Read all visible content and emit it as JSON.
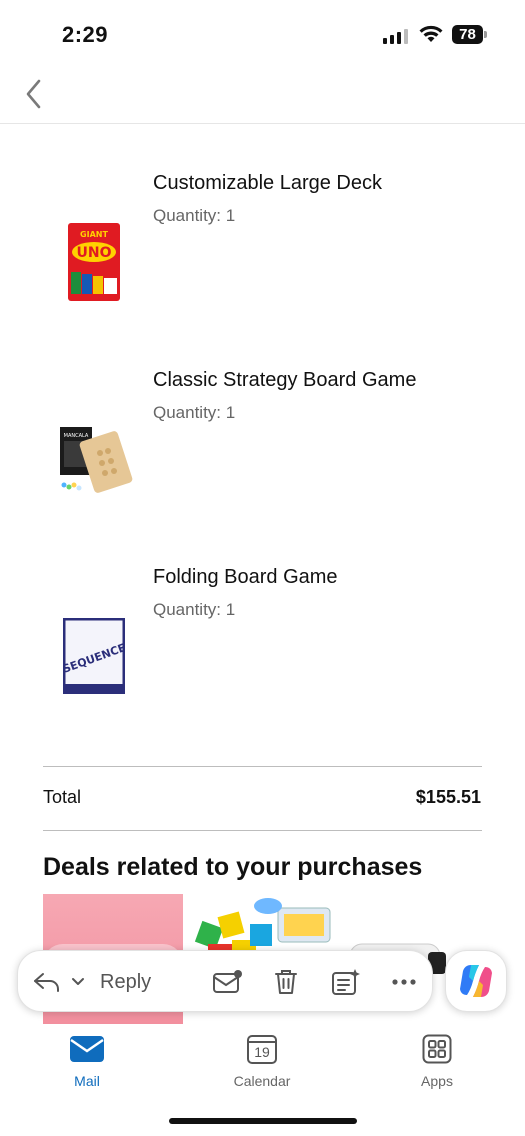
{
  "status_bar": {
    "time": "2:29",
    "battery_level": "78"
  },
  "header": {
    "back_icon": "chevron-left-icon"
  },
  "items": [
    {
      "title": "Customizable Large Deck",
      "quantity": "Quantity: 1",
      "thumb_text": "GIANT UNO"
    },
    {
      "title": "Classic Strategy Board Game",
      "quantity": "Quantity: 1",
      "thumb_text": "MANCALA"
    },
    {
      "title": "Folding Board Game",
      "quantity": "Quantity: 1",
      "thumb_text": "SEQUENCE"
    }
  ],
  "summary": {
    "total_label": "Total",
    "total_value": "$155.51"
  },
  "deals": {
    "title": "Deals related to your purchases"
  },
  "action_bar": {
    "reply_label": "Reply",
    "icons": [
      "reply-icon",
      "chevron-down-icon",
      "mark-unread-icon",
      "trash-icon",
      "summarize-icon",
      "more-icon"
    ]
  },
  "copilot": {
    "icon": "copilot-icon"
  },
  "tabs": [
    {
      "label": "Mail",
      "icon": "mail-icon",
      "active": true
    },
    {
      "label": "Calendar",
      "icon": "calendar-icon",
      "date": "19"
    },
    {
      "label": "Apps",
      "icon": "apps-icon"
    }
  ],
  "colors": {
    "accent": "#0f6cbd",
    "text": "#111111",
    "muted": "#666666"
  }
}
